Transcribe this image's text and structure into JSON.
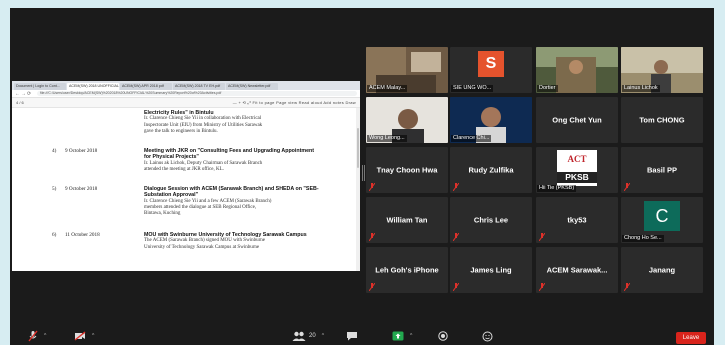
{
  "browser": {
    "tabs": [
      "Document | Login to Cont...",
      "ACEM(SW) 2018 UNOFFICIAL...",
      "ACEM(SW) APR 2018 pdf",
      "ACEM(SW) 2018 TV EH.pdf",
      "ACEM(SW) Newsletter.pdf"
    ],
    "url": "file:///C:/Users/user/Desktop/ACEM(SW)%202018%20UNOFFICIAL%20Summary%20Report%20of%20Activities.pdf",
    "page_indicator": "4 / 6",
    "pdf_tools": "—   +   ⟲   ⤢   Fit to page   Page view   Read aloud   Add notes   Draw"
  },
  "document": {
    "entries": [
      {
        "num": "",
        "date": "",
        "title": "Electricity Rules\" in Bintulu",
        "desc": [
          "Ir. Clarence Chieng Sie Yii in collaboration with Electrical",
          "Inspectorate Unit (EIU) from Ministry of Utilities Sarawak",
          "gave the talk to engineers in Bintulu."
        ]
      },
      {
        "num": "4)",
        "date": "9 October 2018",
        "title": "Meeting with JKR on \"Consulting Fees and Upgrading Appointment for Physical Projects\"",
        "desc": [
          "Ir. Lainus ak Lichok, Deputy Chairman of Sarawak Branch",
          "attended the meeting at JKR office, KL."
        ]
      },
      {
        "num": "5)",
        "date": "9 October 2018",
        "title": "Dialogue Session with ACEM (Sarawak Branch) and SHEDA on \"SEB-Substation Approval\"",
        "desc": [
          "Ir. Clarence Chieng Sie Yii and a few ACEM (Sarawak Branch)",
          "members attended the dialogue at SEB Regional Office,",
          "Bintawa, Kuching"
        ]
      },
      {
        "num": "6)",
        "date": "11 October 2018",
        "title": "MOU with Swinburne University of Technology Sarawak Campus",
        "desc": [
          "The ACEM (Sarawak Branch) signed MOU with Swinburne",
          "University of Technology Sarawak Campus at Swinburne"
        ]
      }
    ]
  },
  "gallery": {
    "video_tiles": [
      {
        "caption": "ACEM Malay..."
      },
      {
        "caption": "SIE UNG WO...",
        "avatar_letter": "S"
      },
      {
        "caption": "Dortier"
      },
      {
        "caption": "Lainus Lichok"
      },
      {
        "caption": "Wong Leong..."
      },
      {
        "caption": "Clarence Chi..."
      }
    ],
    "name_tiles": [
      {
        "name": "Ong Chet Yun"
      },
      {
        "name": "Tom CHONG"
      },
      {
        "name": "Tnay Choon Hwa"
      },
      {
        "name": "Rudy Zulfika"
      },
      {
        "name": "Basil PP"
      },
      {
        "name": "William Tan"
      },
      {
        "name": "Chris Lee"
      },
      {
        "name": "tky53"
      },
      {
        "name": "Leh Goh's iPhone"
      },
      {
        "name": "James Ling"
      },
      {
        "name": "ACEM  Sarawak..."
      },
      {
        "name": "Janang"
      }
    ],
    "pksb_tile": {
      "logo": "ACT",
      "text": "PKSB",
      "caption": "Hii Tie (PKSB)"
    },
    "c_tile": {
      "letter": "C",
      "caption": "Chong Ho Se..."
    }
  },
  "toolbar": {
    "participants_count": "20",
    "leave_label": "Leave"
  },
  "colors": {
    "background": "#d7edf2",
    "meeting_bg": "#1b1b1b",
    "tile_bg": "#2b2b2b",
    "active_speaker": "#c8d93a",
    "muted_red": "#e0312a",
    "leave_red": "#d9241c",
    "share_button_green": "#22a94f"
  }
}
